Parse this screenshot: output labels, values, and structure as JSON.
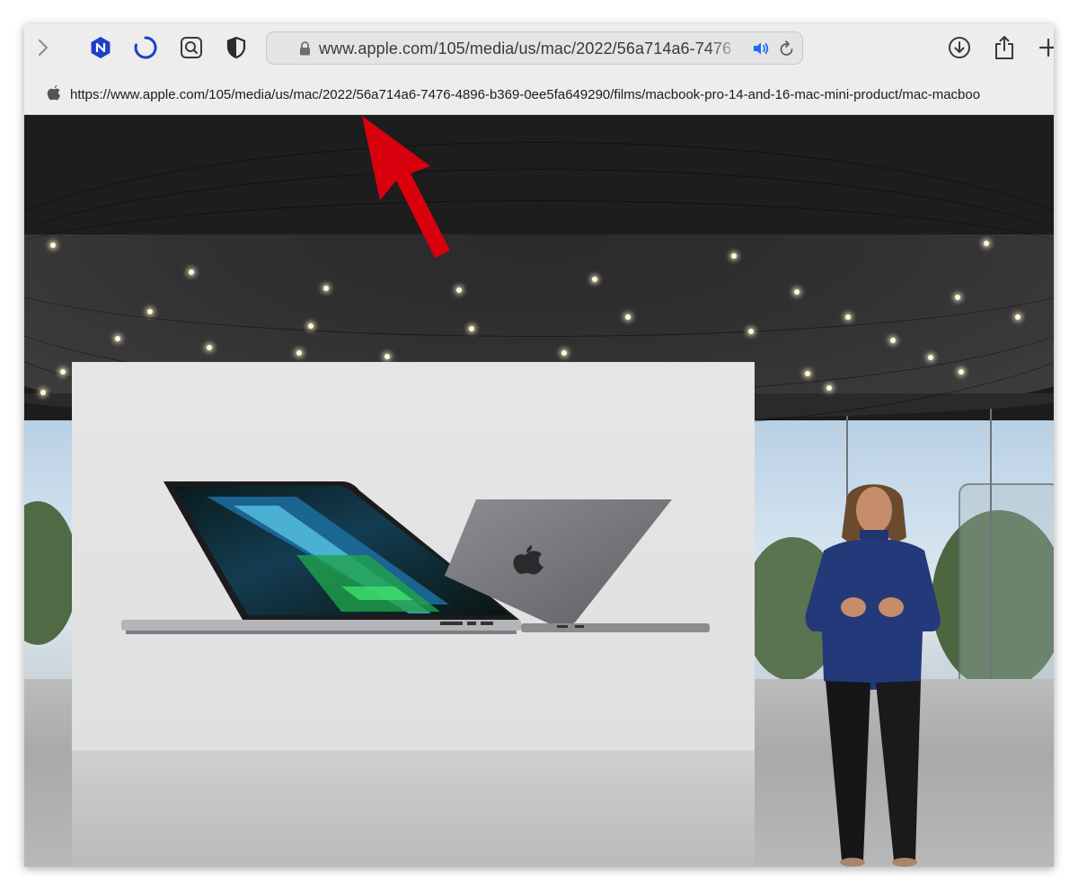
{
  "toolbar": {
    "forward_icon": "chevron-right-icon",
    "extension_icons": [
      "hexagon-extension-icon",
      "loading-spinner-icon",
      "search-extension-icon",
      "shield-privacy-icon"
    ],
    "address": {
      "url_display": "www.apple.com/105/media/us/mac/2022/56a714a6-7476",
      "lock_icon": "lock-icon",
      "speaker_icon": "speaker-icon",
      "reload_icon": "reload-icon"
    },
    "right_icons": [
      "download-icon",
      "share-icon",
      "new-tab-icon"
    ]
  },
  "url_strip": {
    "site_icon": "apple-logo-icon",
    "full_url": "https://www.apple.com/105/media/us/mac/2022/56a714a6-7476-4896-b369-0ee5fa649290/films/macbook-pro-14-and-16-mac-mini-product/mac-macboo"
  },
  "video": {
    "scene": "Apple keynote video frame",
    "annotation": "red-arrow-pointing-to-url"
  },
  "colors": {
    "toolbar_bg": "#ededee",
    "accent_blue": "#1f4fd1",
    "arrow_red": "#d9000d"
  }
}
